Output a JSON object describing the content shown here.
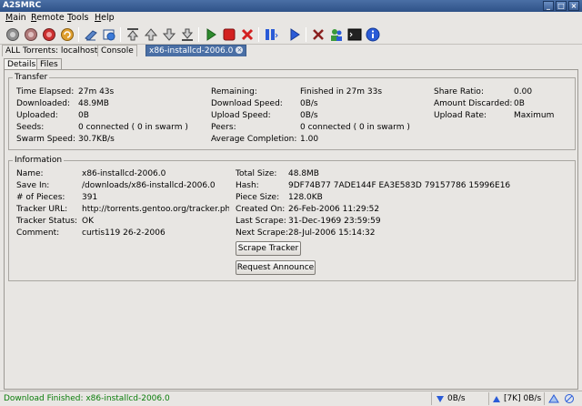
{
  "window": {
    "title": "A2SMRC",
    "controls": [
      "_",
      "□",
      "×"
    ]
  },
  "menu": [
    {
      "label": "Main",
      "key": "M",
      "rest": "ain"
    },
    {
      "label": "Remote",
      "key": "R",
      "rest": "emote"
    },
    {
      "label": "Tools",
      "key": "T",
      "rest": "ools"
    },
    {
      "label": "Help",
      "key": "H",
      "rest": "elp"
    }
  ],
  "toolbar": {
    "icons": [
      "connect-icon",
      "disconnect-icon",
      "stop-connection-icon",
      "refresh-icon",
      "open-torrent-icon",
      "open-url-icon",
      "move-top-icon",
      "move-up-icon",
      "move-down-icon",
      "move-bottom-icon",
      "start-icon",
      "stop-icon",
      "remove-icon",
      "pause-icon",
      "resume-icon",
      "preferences-icon",
      "users-icon",
      "console-icon",
      "info-icon"
    ],
    "colors": {
      "green": "#2e8b2e",
      "red": "#d32020",
      "blue": "#2a5bd7"
    }
  },
  "tabs": [
    {
      "label": "ALL Torrents: localhost",
      "active": false
    },
    {
      "label": "Console",
      "active": false
    },
    {
      "label": "x86-installcd-2006.0",
      "active": true
    }
  ],
  "subtabs": [
    {
      "label": "Details",
      "active": true
    },
    {
      "label": "Files",
      "active": false
    }
  ],
  "transfer": {
    "title": "Transfer",
    "col1": [
      {
        "label": "Time Elapsed:",
        "value": "27m 43s"
      },
      {
        "label": "Downloaded:",
        "value": "48.9MB"
      },
      {
        "label": "Uploaded:",
        "value": "0B"
      },
      {
        "label": "Seeds:",
        "value": "0 connected ( 0 in swarm )"
      },
      {
        "label": "Swarm Speed:",
        "value": "30.7KB/s"
      }
    ],
    "col2": [
      {
        "label": "Remaining:",
        "value": "Finished in 27m 33s"
      },
      {
        "label": "Download Speed:",
        "value": "0B/s"
      },
      {
        "label": "Upload Speed:",
        "value": "0B/s"
      },
      {
        "label": "Peers:",
        "value": "0 connected ( 0 in swarm )"
      },
      {
        "label": "Average Completion:",
        "value": "1.00"
      }
    ],
    "col3": [
      {
        "label": "Share Ratio:",
        "value": "0.00"
      },
      {
        "label": "Amount Discarded:",
        "value": "0B"
      },
      {
        "label": "Upload Rate:",
        "value": "Maximum"
      }
    ]
  },
  "information": {
    "title": "Information",
    "col1": [
      {
        "label": "Name:",
        "value": "x86-installcd-2006.0"
      },
      {
        "label": "Save In:",
        "value": "/downloads/x86-installcd-2006.0"
      },
      {
        "label": "# of Pieces:",
        "value": "391"
      },
      {
        "label": "Tracker URL:",
        "value": "http://torrents.gentoo.org/tracker.php"
      },
      {
        "label": "Tracker Status:",
        "value": "OK"
      },
      {
        "label": "Comment:",
        "value": "curtis119 26-2-2006"
      }
    ],
    "col2": [
      {
        "label": "Total Size:",
        "value": "48.8MB"
      },
      {
        "label": "Hash:",
        "value": "9DF74B77 7ADE144F EA3E583D 79157786 15996E16"
      },
      {
        "label": "Piece Size:",
        "value": "128.0KB"
      },
      {
        "label": "Created On:",
        "value": "26-Feb-2006 11:29:52"
      },
      {
        "label": "Last Scrape:",
        "value": "31-Dec-1969 23:59:59"
      },
      {
        "label": "Next Scrape:",
        "value": "28-Jul-2006 15:14:32"
      }
    ],
    "scrape_button": "Scrape Tracker",
    "announce_button": "Request Announce"
  },
  "statusbar": {
    "message": "Download Finished: x86-installcd-2006.0",
    "down_speed": "0B/s",
    "up_info": "[7K] 0B/s"
  }
}
